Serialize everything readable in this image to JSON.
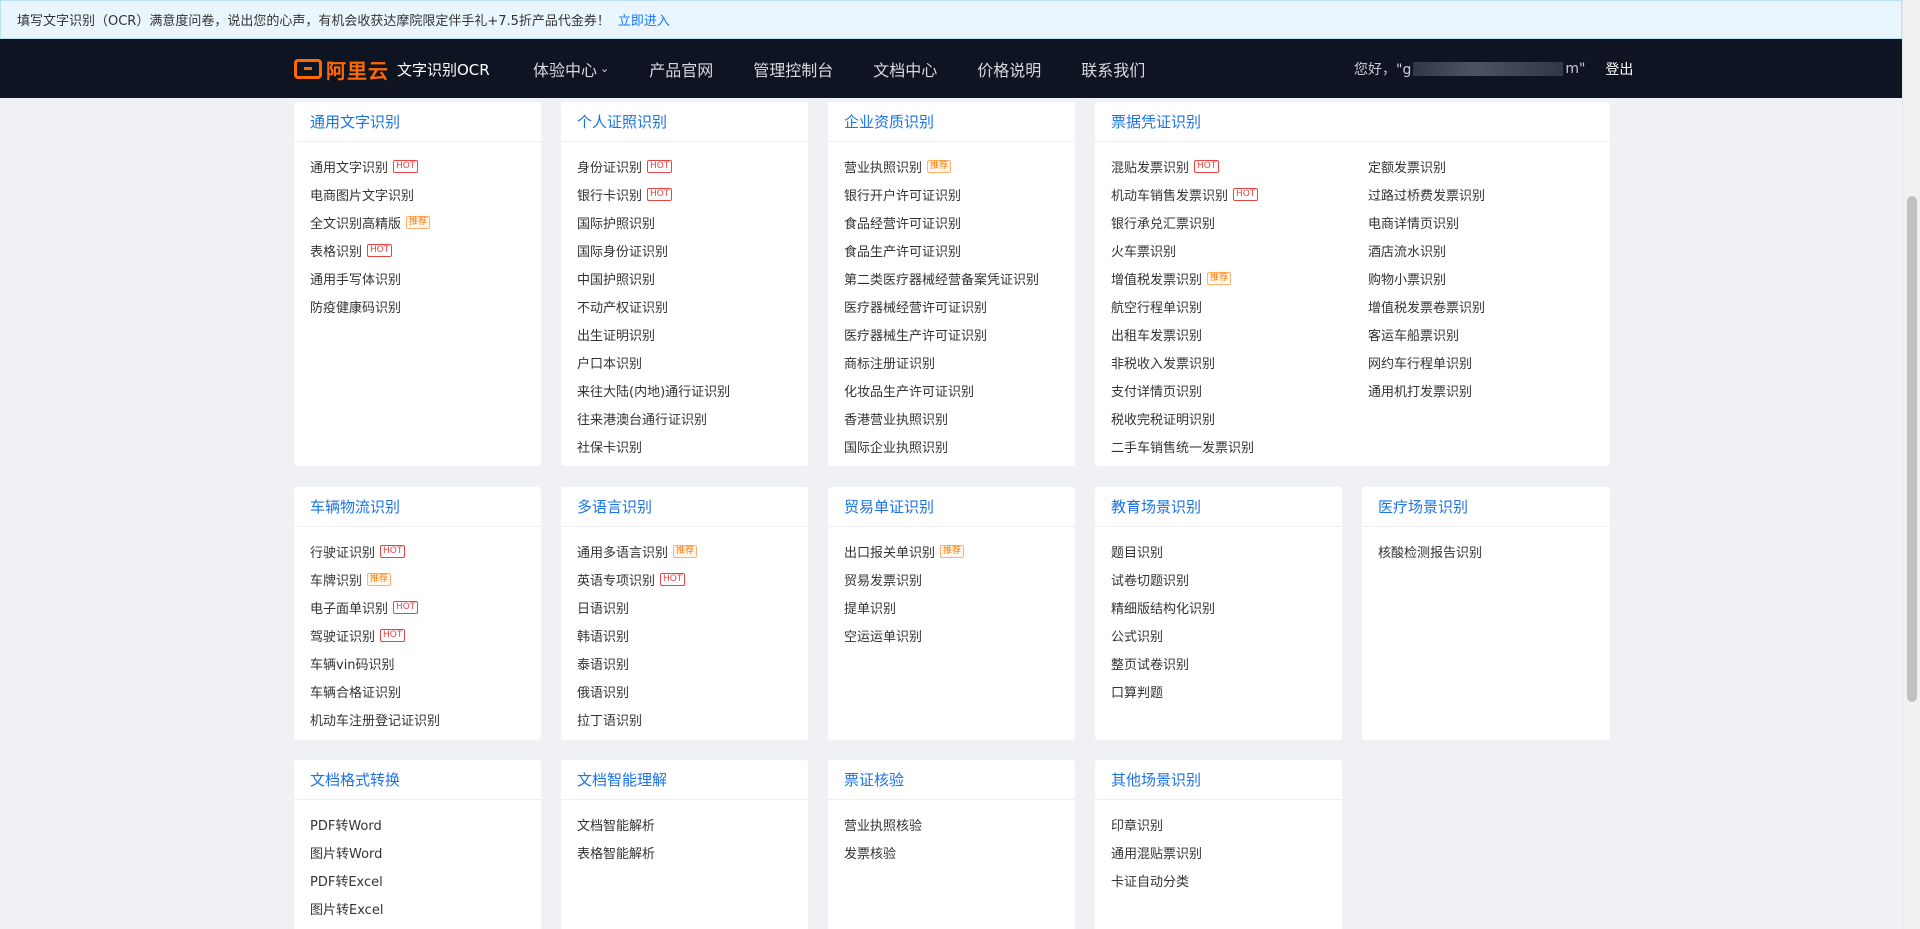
{
  "notice": {
    "text": "填写文字识别（OCR）满意度问卷，说出您的心声，有机会收获达摩院限定伴手礼+7.5折产品代金券！",
    "link": "立即进入"
  },
  "nav": {
    "brand": "阿里云",
    "product": "文字识别OCR",
    "items": [
      "体验中心",
      "产品官网",
      "管理控制台",
      "文档中心",
      "价格说明",
      "联系我们"
    ],
    "greeting_prefix": "您好，\"g",
    "greeting_suffix": "m\"",
    "logout": "登出"
  },
  "cards": [
    {
      "title": "通用文字识别",
      "items": [
        {
          "label": "通用文字识别",
          "badge": "HOT"
        },
        {
          "label": "电商图片文字识别"
        },
        {
          "label": "全文识别高精版",
          "badge": "推荐"
        },
        {
          "label": "表格识别",
          "badge": "HOT"
        },
        {
          "label": "通用手写体识别"
        },
        {
          "label": "防疫健康码识别"
        }
      ]
    },
    {
      "title": "个人证照识别",
      "items": [
        {
          "label": "身份证识别",
          "badge": "HOT"
        },
        {
          "label": "银行卡识别",
          "badge": "HOT"
        },
        {
          "label": "国际护照识别"
        },
        {
          "label": "国际身份证识别"
        },
        {
          "label": "中国护照识别"
        },
        {
          "label": "不动产权证识别"
        },
        {
          "label": "出生证明识别"
        },
        {
          "label": "户口本识别"
        },
        {
          "label": "来往大陆(内地)通行证识别"
        },
        {
          "label": "往来港澳台通行证识别"
        },
        {
          "label": "社保卡识别"
        }
      ]
    },
    {
      "title": "企业资质识别",
      "items": [
        {
          "label": "营业执照识别",
          "badge": "推荐"
        },
        {
          "label": "银行开户许可证识别"
        },
        {
          "label": "食品经营许可证识别"
        },
        {
          "label": "食品生产许可证识别"
        },
        {
          "label": "第二类医疗器械经营备案凭证识别"
        },
        {
          "label": "医疗器械经营许可证识别"
        },
        {
          "label": "医疗器械生产许可证识别"
        },
        {
          "label": "商标注册证识别"
        },
        {
          "label": "化妆品生产许可证识别"
        },
        {
          "label": "香港营业执照识别"
        },
        {
          "label": "国际企业执照识别"
        }
      ]
    },
    {
      "title": "票据凭证识别",
      "items": [
        {
          "label": "混贴发票识别",
          "badge": "HOT"
        },
        {
          "label": "机动车销售发票识别",
          "badge": "HOT"
        },
        {
          "label": "银行承兑汇票识别"
        },
        {
          "label": "火车票识别"
        },
        {
          "label": "增值税发票识别",
          "badge": "推荐"
        },
        {
          "label": "航空行程单识别"
        },
        {
          "label": "出租车发票识别"
        },
        {
          "label": "非税收入发票识别"
        },
        {
          "label": "支付详情页识别"
        },
        {
          "label": "税收完税证明识别"
        },
        {
          "label": "二手车销售统一发票识别"
        }
      ],
      "items2": [
        {
          "label": "定额发票识别"
        },
        {
          "label": "过路过桥费发票识别"
        },
        {
          "label": "电商详情页识别"
        },
        {
          "label": "酒店流水识别"
        },
        {
          "label": "购物小票识别"
        },
        {
          "label": "增值税发票卷票识别"
        },
        {
          "label": "客运车船票识别"
        },
        {
          "label": "网约车行程单识别"
        },
        {
          "label": "通用机打发票识别"
        }
      ]
    },
    {
      "title": "车辆物流识别",
      "items": [
        {
          "label": "行驶证识别",
          "badge": "HOT"
        },
        {
          "label": "车牌识别",
          "badge": "推荐"
        },
        {
          "label": "电子面单识别",
          "badge": "HOT"
        },
        {
          "label": "驾驶证识别",
          "badge": "HOT"
        },
        {
          "label": "车辆vin码识别"
        },
        {
          "label": "车辆合格证识别"
        },
        {
          "label": "机动车注册登记证识别"
        }
      ]
    },
    {
      "title": "多语言识别",
      "items": [
        {
          "label": "通用多语言识别",
          "badge": "推荐"
        },
        {
          "label": "英语专项识别",
          "badge": "HOT"
        },
        {
          "label": "日语识别"
        },
        {
          "label": "韩语识别"
        },
        {
          "label": "泰语识别"
        },
        {
          "label": "俄语识别"
        },
        {
          "label": "拉丁语识别"
        }
      ]
    },
    {
      "title": "贸易单证识别",
      "items": [
        {
          "label": "出口报关单识别",
          "badge": "推荐"
        },
        {
          "label": "贸易发票识别"
        },
        {
          "label": "提单识别"
        },
        {
          "label": "空运运单识别"
        }
      ]
    },
    {
      "title": "教育场景识别",
      "items": [
        {
          "label": "题目识别"
        },
        {
          "label": "试卷切题识别"
        },
        {
          "label": "精细版结构化识别"
        },
        {
          "label": "公式识别"
        },
        {
          "label": "整页试卷识别"
        },
        {
          "label": "口算判题"
        }
      ]
    },
    {
      "title": "医疗场景识别",
      "items": [
        {
          "label": "核酸检测报告识别"
        }
      ]
    },
    {
      "title": "文档格式转换",
      "items": [
        {
          "label": "PDF转Word"
        },
        {
          "label": "图片转Word"
        },
        {
          "label": "PDF转Excel"
        },
        {
          "label": "图片转Excel"
        }
      ]
    },
    {
      "title": "文档智能理解",
      "items": [
        {
          "label": "文档智能解析"
        },
        {
          "label": "表格智能解析"
        }
      ]
    },
    {
      "title": "票证核验",
      "items": [
        {
          "label": "营业执照核验"
        },
        {
          "label": "发票核验"
        }
      ]
    },
    {
      "title": "其他场景识别",
      "items": [
        {
          "label": "印章识别"
        },
        {
          "label": "通用混贴票识别"
        },
        {
          "label": "卡证自动分类"
        }
      ]
    }
  ]
}
